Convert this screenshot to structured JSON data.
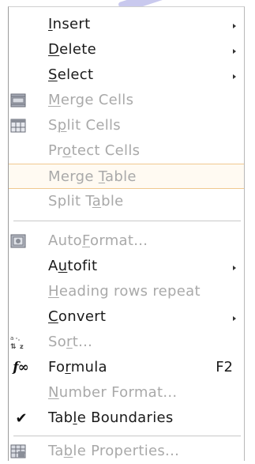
{
  "menu": {
    "items": [
      {
        "id": "insert",
        "before": "",
        "mn": "I",
        "after": "nsert",
        "disabled": false,
        "submenu": true,
        "shortcut": "",
        "icon": ""
      },
      {
        "id": "delete",
        "before": "",
        "mn": "D",
        "after": "elete",
        "disabled": false,
        "submenu": true,
        "shortcut": "",
        "icon": ""
      },
      {
        "id": "select",
        "before": "",
        "mn": "S",
        "after": "elect",
        "disabled": false,
        "submenu": true,
        "shortcut": "",
        "icon": ""
      },
      {
        "id": "merge-cells",
        "before": "",
        "mn": "M",
        "after": "erge Cells",
        "disabled": true,
        "submenu": false,
        "shortcut": "",
        "icon": "merge-cells-icon"
      },
      {
        "id": "split-cells",
        "before": "S",
        "mn": "p",
        "after": "lit Cells",
        "disabled": true,
        "submenu": false,
        "shortcut": "",
        "icon": "split-cells-icon"
      },
      {
        "id": "protect-cells",
        "before": "Pr",
        "mn": "o",
        "after": "tect Cells",
        "disabled": true,
        "submenu": false,
        "shortcut": "",
        "icon": ""
      },
      {
        "id": "merge-table",
        "before": "Merge ",
        "mn": "T",
        "after": "able",
        "disabled": true,
        "submenu": false,
        "shortcut": "",
        "icon": ""
      },
      {
        "id": "split-table",
        "before": "Split T",
        "mn": "a",
        "after": "ble",
        "disabled": true,
        "submenu": false,
        "shortcut": "",
        "icon": ""
      },
      {
        "id": "autoformat",
        "before": "Auto",
        "mn": "F",
        "after": "ormat...",
        "disabled": true,
        "submenu": false,
        "shortcut": "",
        "icon": "autoformat-icon"
      },
      {
        "id": "autofit",
        "before": "A",
        "mn": "u",
        "after": "tofit",
        "disabled": false,
        "submenu": true,
        "shortcut": "",
        "icon": ""
      },
      {
        "id": "heading-rows-repeat",
        "before": "",
        "mn": "H",
        "after": "eading rows repeat",
        "disabled": true,
        "submenu": false,
        "shortcut": "",
        "icon": ""
      },
      {
        "id": "convert",
        "before": "",
        "mn": "C",
        "after": "onvert",
        "disabled": false,
        "submenu": true,
        "shortcut": "",
        "icon": ""
      },
      {
        "id": "sort",
        "before": "So",
        "mn": "r",
        "after": "t...",
        "disabled": true,
        "submenu": false,
        "shortcut": "",
        "icon": "sort-icon"
      },
      {
        "id": "formula",
        "before": "Fo",
        "mn": "r",
        "after": "mula",
        "disabled": false,
        "submenu": false,
        "shortcut": "F2",
        "icon": "formula-icon"
      },
      {
        "id": "number-format",
        "before": "",
        "mn": "N",
        "after": "umber Format...",
        "disabled": true,
        "submenu": false,
        "shortcut": "",
        "icon": ""
      },
      {
        "id": "table-boundaries",
        "before": "Tab",
        "mn": "l",
        "after": "e Boundaries",
        "disabled": false,
        "submenu": false,
        "shortcut": "",
        "icon": "checkmark-icon"
      },
      {
        "id": "table-properties",
        "before": "Ta",
        "mn": "b",
        "after": "le Properties...",
        "disabled": true,
        "submenu": false,
        "shortcut": "",
        "icon": "table-properties-icon"
      }
    ],
    "highlighted": "merge-table",
    "formula_icon_text": "f∞",
    "check_symbol": "✔",
    "colors": {
      "text": "#1a1a1a",
      "disabled": "#a9a9a9",
      "highlight_border": "#f0c890",
      "separator": "#c8c8c8"
    }
  }
}
